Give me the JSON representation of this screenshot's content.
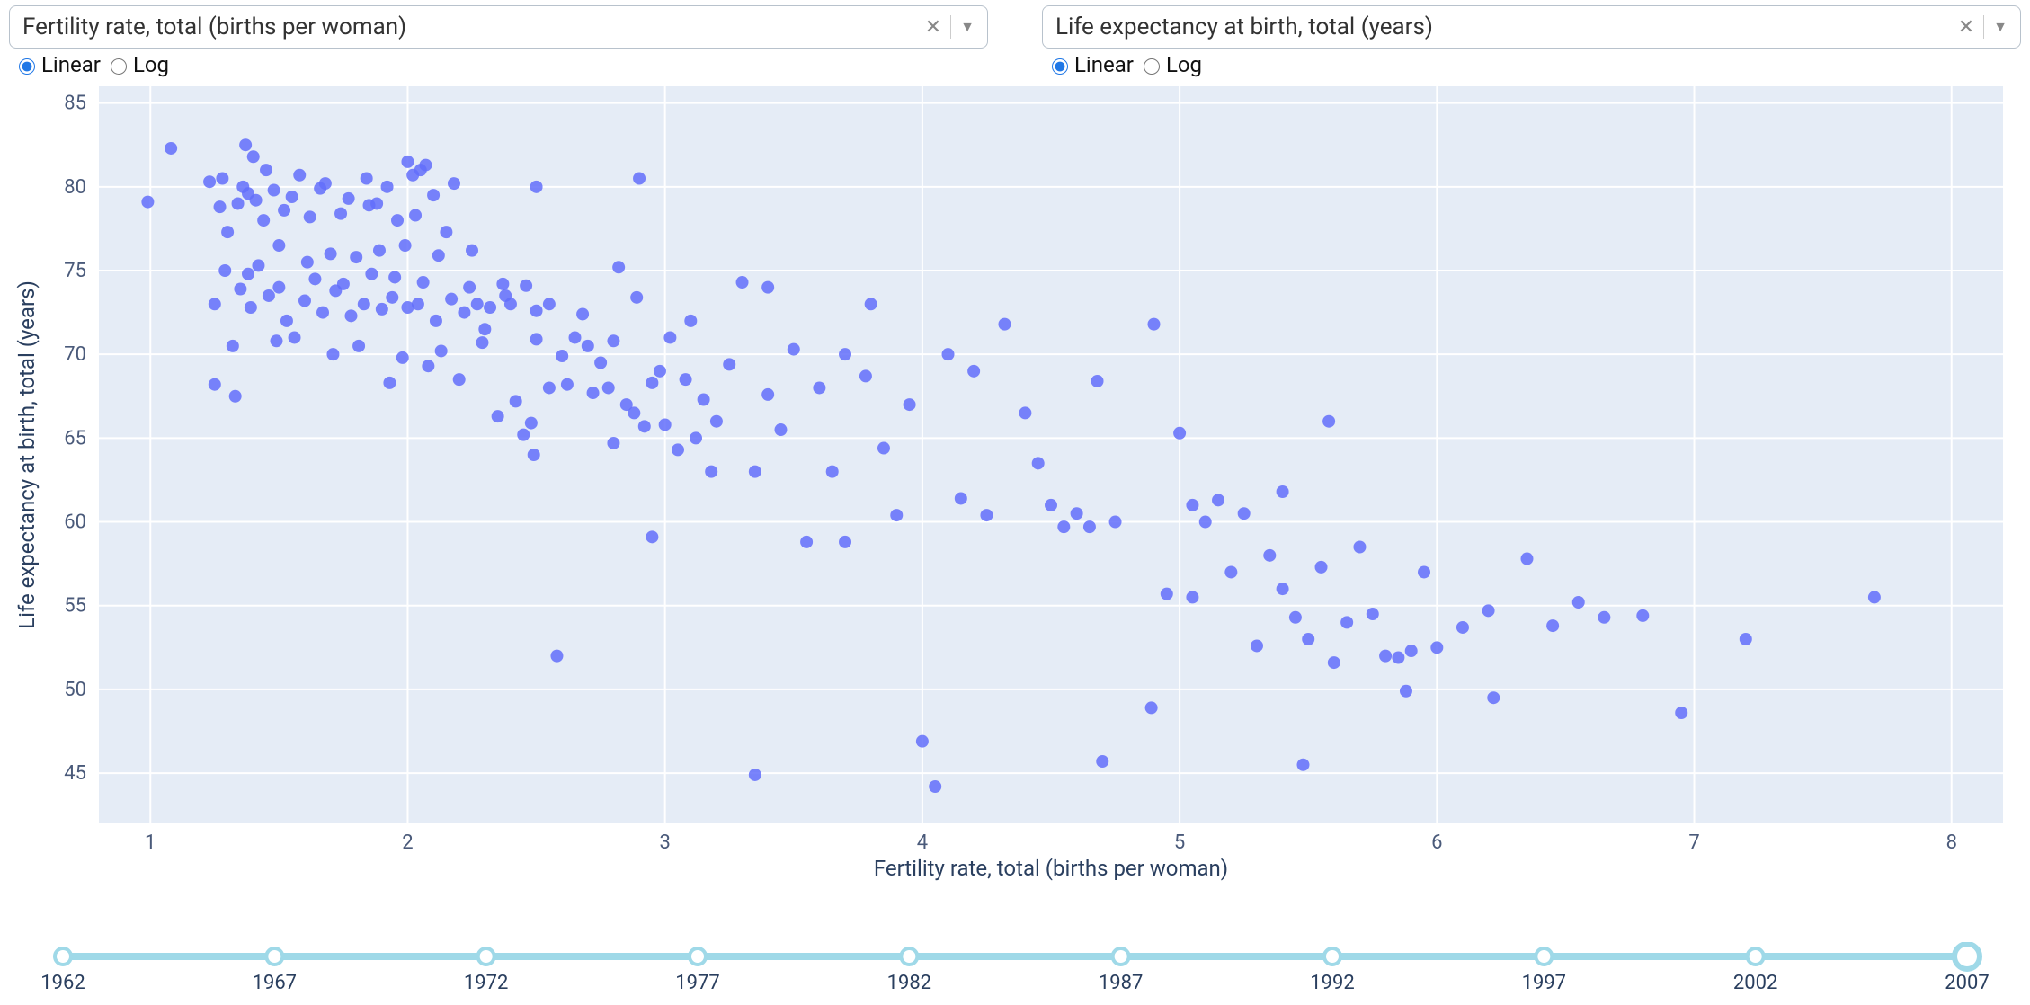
{
  "x_dropdown": {
    "label": "Fertility rate, total (births per woman)"
  },
  "y_dropdown": {
    "label": "Life expectancy at birth, total (years)"
  },
  "scale": {
    "linear": "Linear",
    "log": "Log",
    "x_selected": "linear",
    "y_selected": "linear"
  },
  "timeline": {
    "years": [
      "1962",
      "1967",
      "1972",
      "1977",
      "1982",
      "1987",
      "1992",
      "1997",
      "2002",
      "2007"
    ],
    "selected": "2007"
  },
  "chart_data": {
    "type": "scatter",
    "xlabel": "Fertility rate, total (births per woman)",
    "ylabel": "Life expectancy at birth, total (years)",
    "xlim": [
      0.8,
      8.2
    ],
    "ylim": [
      42,
      86
    ],
    "xticks": [
      1,
      2,
      3,
      4,
      5,
      6,
      7,
      8
    ],
    "yticks": [
      45,
      50,
      55,
      60,
      65,
      70,
      75,
      80,
      85
    ],
    "points": [
      [
        0.99,
        79.1
      ],
      [
        1.08,
        82.3
      ],
      [
        1.25,
        68.2
      ],
      [
        1.23,
        80.3
      ],
      [
        1.25,
        73.0
      ],
      [
        1.27,
        78.8
      ],
      [
        1.28,
        80.5
      ],
      [
        1.29,
        75.0
      ],
      [
        1.3,
        77.3
      ],
      [
        1.32,
        70.5
      ],
      [
        1.33,
        67.5
      ],
      [
        1.34,
        79.0
      ],
      [
        1.35,
        73.9
      ],
      [
        1.36,
        80.0
      ],
      [
        1.37,
        82.5
      ],
      [
        1.38,
        79.6
      ],
      [
        1.38,
        74.8
      ],
      [
        1.39,
        72.8
      ],
      [
        1.4,
        81.8
      ],
      [
        1.41,
        79.2
      ],
      [
        1.42,
        75.3
      ],
      [
        1.44,
        78.0
      ],
      [
        1.45,
        81.0
      ],
      [
        1.46,
        73.5
      ],
      [
        1.48,
        79.8
      ],
      [
        1.49,
        70.8
      ],
      [
        1.5,
        76.5
      ],
      [
        1.5,
        74.0
      ],
      [
        1.52,
        78.6
      ],
      [
        1.53,
        72.0
      ],
      [
        1.55,
        79.4
      ],
      [
        1.56,
        71.0
      ],
      [
        1.58,
        80.7
      ],
      [
        1.6,
        73.2
      ],
      [
        1.61,
        75.5
      ],
      [
        1.62,
        78.2
      ],
      [
        1.64,
        74.5
      ],
      [
        1.66,
        79.9
      ],
      [
        1.67,
        72.5
      ],
      [
        1.68,
        80.2
      ],
      [
        1.7,
        76.0
      ],
      [
        1.71,
        70.0
      ],
      [
        1.72,
        73.8
      ],
      [
        1.74,
        78.4
      ],
      [
        1.75,
        74.2
      ],
      [
        1.77,
        79.3
      ],
      [
        1.78,
        72.3
      ],
      [
        1.8,
        75.8
      ],
      [
        1.81,
        70.5
      ],
      [
        1.83,
        73.0
      ],
      [
        1.84,
        80.5
      ],
      [
        1.85,
        78.9
      ],
      [
        1.86,
        74.8
      ],
      [
        1.88,
        79.0
      ],
      [
        1.89,
        76.2
      ],
      [
        1.9,
        72.7
      ],
      [
        1.92,
        80.0
      ],
      [
        1.93,
        68.3
      ],
      [
        1.94,
        73.4
      ],
      [
        1.95,
        74.6
      ],
      [
        1.96,
        78.0
      ],
      [
        1.98,
        69.8
      ],
      [
        1.99,
        76.5
      ],
      [
        2.0,
        81.5
      ],
      [
        2.0,
        72.8
      ],
      [
        2.02,
        80.7
      ],
      [
        2.03,
        78.3
      ],
      [
        2.04,
        73.0
      ],
      [
        2.05,
        81.0
      ],
      [
        2.06,
        74.3
      ],
      [
        2.07,
        81.3
      ],
      [
        2.08,
        69.3
      ],
      [
        2.1,
        79.5
      ],
      [
        2.11,
        72.0
      ],
      [
        2.12,
        75.9
      ],
      [
        2.13,
        70.2
      ],
      [
        2.15,
        77.3
      ],
      [
        2.17,
        73.3
      ],
      [
        2.18,
        80.2
      ],
      [
        2.2,
        68.5
      ],
      [
        2.22,
        72.5
      ],
      [
        2.24,
        74.0
      ],
      [
        2.25,
        76.2
      ],
      [
        2.27,
        73.0
      ],
      [
        2.29,
        70.7
      ],
      [
        2.3,
        71.5
      ],
      [
        2.32,
        72.8
      ],
      [
        2.35,
        66.3
      ],
      [
        2.37,
        74.2
      ],
      [
        2.38,
        73.5
      ],
      [
        2.4,
        73.0
      ],
      [
        2.42,
        67.2
      ],
      [
        2.45,
        65.2
      ],
      [
        2.46,
        74.1
      ],
      [
        2.48,
        65.9
      ],
      [
        2.49,
        64.0
      ],
      [
        2.5,
        72.6
      ],
      [
        2.5,
        70.9
      ],
      [
        2.5,
        80.0
      ],
      [
        2.55,
        73.0
      ],
      [
        2.55,
        68.0
      ],
      [
        2.58,
        52.0
      ],
      [
        2.6,
        69.9
      ],
      [
        2.62,
        68.2
      ],
      [
        2.65,
        71.0
      ],
      [
        2.68,
        72.4
      ],
      [
        2.7,
        70.5
      ],
      [
        2.72,
        67.7
      ],
      [
        2.75,
        69.5
      ],
      [
        2.78,
        68.0
      ],
      [
        2.8,
        70.8
      ],
      [
        2.8,
        64.7
      ],
      [
        2.82,
        75.2
      ],
      [
        2.85,
        67.0
      ],
      [
        2.88,
        66.5
      ],
      [
        2.89,
        73.4
      ],
      [
        2.9,
        80.5
      ],
      [
        2.92,
        65.7
      ],
      [
        2.95,
        68.3
      ],
      [
        2.95,
        59.1
      ],
      [
        2.98,
        69.0
      ],
      [
        3.0,
        65.8
      ],
      [
        3.02,
        71.0
      ],
      [
        3.05,
        64.3
      ],
      [
        3.08,
        68.5
      ],
      [
        3.1,
        72.0
      ],
      [
        3.12,
        65.0
      ],
      [
        3.15,
        67.3
      ],
      [
        3.18,
        63.0
      ],
      [
        3.2,
        66.0
      ],
      [
        3.25,
        69.4
      ],
      [
        3.3,
        74.3
      ],
      [
        3.35,
        63.0
      ],
      [
        3.35,
        44.9
      ],
      [
        3.4,
        67.6
      ],
      [
        3.4,
        74.0
      ],
      [
        3.45,
        65.5
      ],
      [
        3.5,
        70.3
      ],
      [
        3.55,
        58.8
      ],
      [
        3.6,
        68.0
      ],
      [
        3.65,
        63.0
      ],
      [
        3.7,
        70.0
      ],
      [
        3.7,
        58.8
      ],
      [
        3.78,
        68.7
      ],
      [
        3.8,
        73.0
      ],
      [
        3.85,
        64.4
      ],
      [
        3.9,
        60.4
      ],
      [
        3.95,
        67.0
      ],
      [
        4.0,
        46.9
      ],
      [
        4.05,
        44.2
      ],
      [
        4.1,
        70.0
      ],
      [
        4.15,
        61.4
      ],
      [
        4.2,
        69.0
      ],
      [
        4.25,
        60.4
      ],
      [
        4.32,
        71.8
      ],
      [
        4.4,
        66.5
      ],
      [
        4.45,
        63.5
      ],
      [
        4.5,
        61.0
      ],
      [
        4.55,
        59.7
      ],
      [
        4.6,
        60.5
      ],
      [
        4.65,
        59.7
      ],
      [
        4.68,
        68.4
      ],
      [
        4.7,
        45.7
      ],
      [
        4.75,
        60.0
      ],
      [
        4.89,
        48.9
      ],
      [
        4.9,
        71.8
      ],
      [
        4.95,
        55.7
      ],
      [
        5.0,
        65.3
      ],
      [
        5.05,
        55.5
      ],
      [
        5.05,
        61.0
      ],
      [
        5.1,
        60.0
      ],
      [
        5.15,
        61.3
      ],
      [
        5.2,
        57.0
      ],
      [
        5.25,
        60.5
      ],
      [
        5.3,
        52.6
      ],
      [
        5.35,
        58.0
      ],
      [
        5.4,
        61.8
      ],
      [
        5.4,
        56.0
      ],
      [
        5.45,
        54.3
      ],
      [
        5.48,
        45.5
      ],
      [
        5.5,
        53.0
      ],
      [
        5.55,
        57.3
      ],
      [
        5.58,
        66.0
      ],
      [
        5.6,
        51.6
      ],
      [
        5.65,
        54.0
      ],
      [
        5.7,
        58.5
      ],
      [
        5.75,
        54.5
      ],
      [
        5.8,
        52.0
      ],
      [
        5.85,
        51.9
      ],
      [
        5.88,
        49.9
      ],
      [
        5.9,
        52.3
      ],
      [
        5.95,
        57.0
      ],
      [
        6.0,
        52.5
      ],
      [
        6.1,
        53.7
      ],
      [
        6.2,
        54.7
      ],
      [
        6.22,
        49.5
      ],
      [
        6.35,
        57.8
      ],
      [
        6.45,
        53.8
      ],
      [
        6.55,
        55.2
      ],
      [
        6.65,
        54.3
      ],
      [
        6.8,
        54.4
      ],
      [
        6.95,
        48.6
      ],
      [
        7.2,
        53.0
      ],
      [
        7.7,
        55.5
      ]
    ]
  }
}
